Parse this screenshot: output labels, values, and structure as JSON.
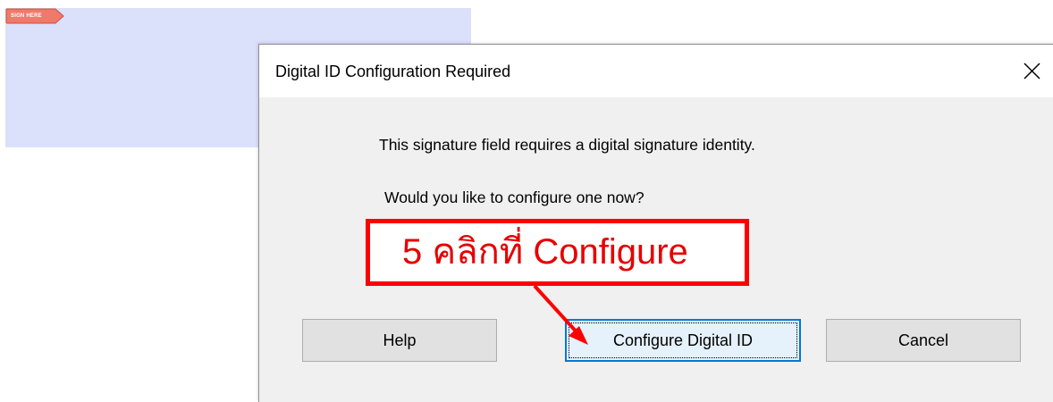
{
  "signature_field": {
    "tag_label": "SIGN HERE",
    "tag_color": "#f07a6a"
  },
  "dialog": {
    "title": "Digital ID Configuration Required",
    "message_line1": "This signature field requires a digital signature identity.",
    "message_line2": "Would you like to configure one now?",
    "buttons": {
      "help": "Help",
      "configure": "Configure Digital ID",
      "cancel": "Cancel"
    },
    "close_icon": "close-icon"
  },
  "annotation": {
    "text": "5 คลิกที่ Configure",
    "color": "#ff0000"
  }
}
